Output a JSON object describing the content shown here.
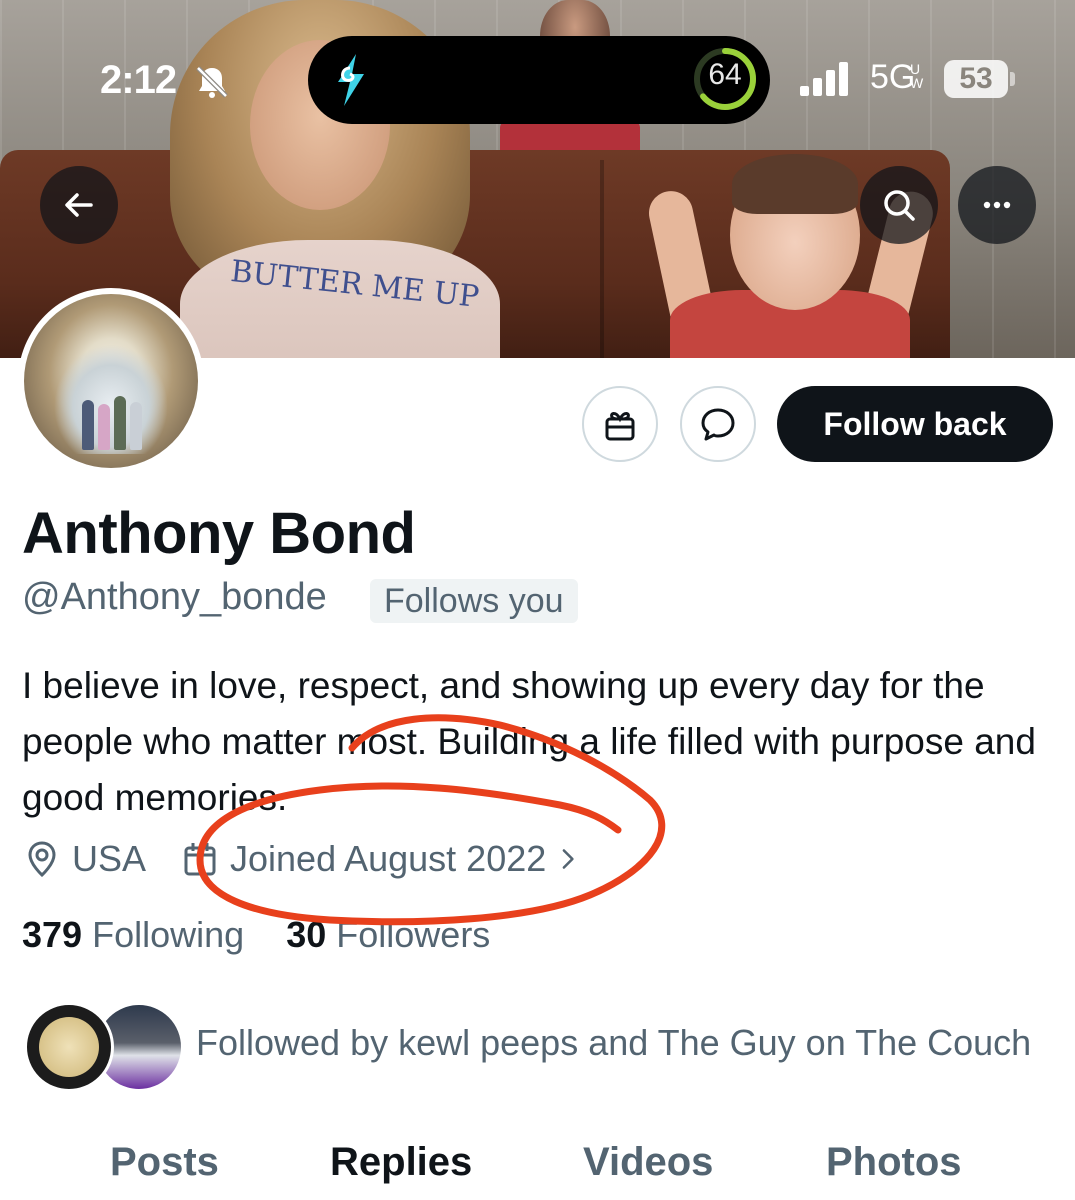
{
  "status_bar": {
    "time": "2:12",
    "island_score": "64",
    "network": "5G",
    "network_sub": "UW",
    "battery": "53"
  },
  "banner": {
    "shirt_text": "BUTTER ME UP"
  },
  "profile": {
    "name": "Anthony Bond",
    "handle": "@Anthony_bonde",
    "follows_you": "Follows you",
    "bio": "I believe in love, respect, and showing up every day for the people who matter most. Building a life filled with purpose and good memories.",
    "location": "USA",
    "joined": "Joined August 2022"
  },
  "stats": {
    "following_count": "379",
    "following_label": "Following",
    "followers_count": "30",
    "followers_label": "Followers"
  },
  "followed_by": "Followed by kewl peeps and The Guy on The Couch",
  "actions": {
    "follow_back": "Follow back"
  },
  "tabs": [
    {
      "label": "Posts",
      "active": false
    },
    {
      "label": "Replies",
      "active": true
    },
    {
      "label": "Videos",
      "active": false
    },
    {
      "label": "Photos",
      "active": false
    }
  ],
  "icons": {
    "back": "arrow-left-icon",
    "search": "search-icon",
    "more": "more-icon",
    "gift": "gift-icon",
    "message": "message-icon",
    "location": "location-pin-icon",
    "calendar": "calendar-icon",
    "chevron": "chevron-right-icon"
  },
  "colors": {
    "primary_text": "#0f1419",
    "secondary_text": "#536471",
    "annotation": "#e8401c"
  }
}
